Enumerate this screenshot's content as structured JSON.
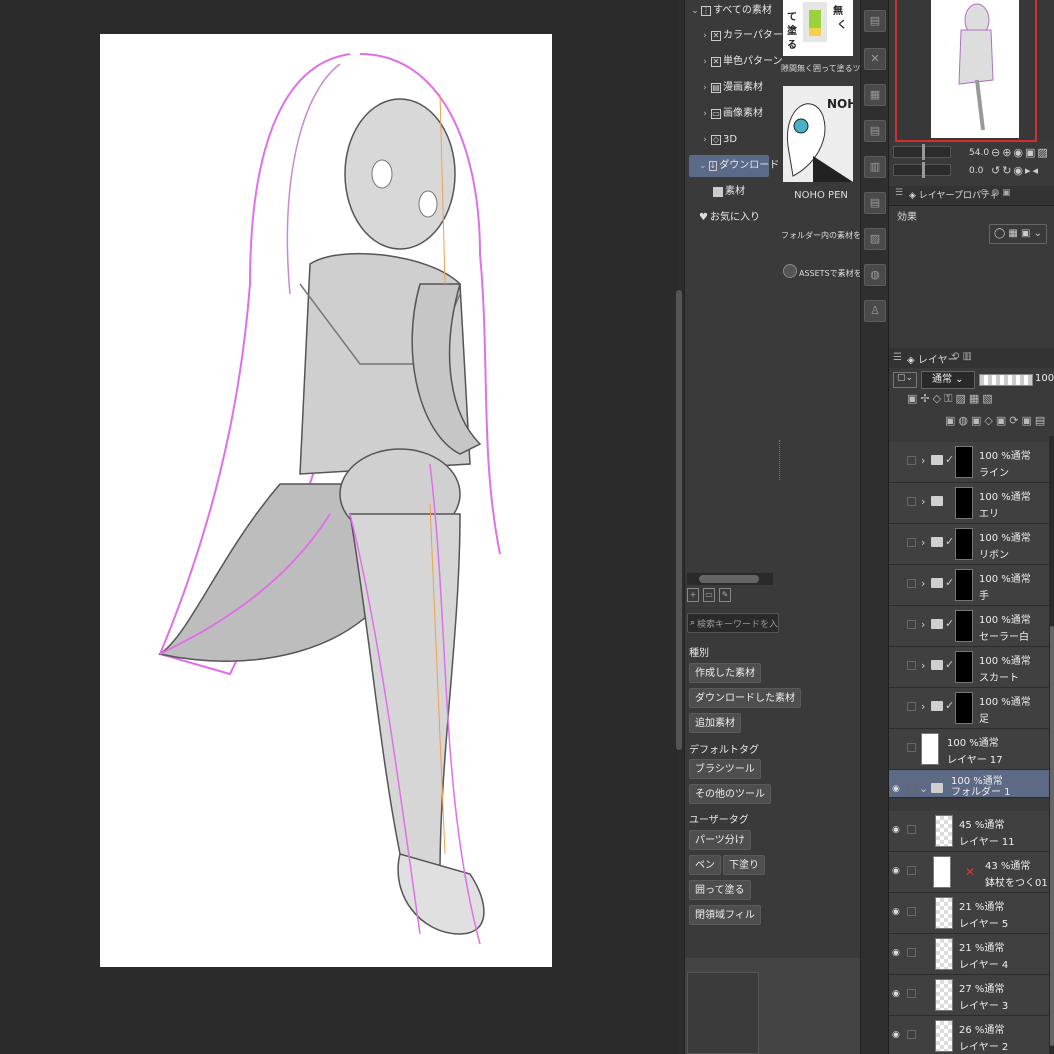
{
  "materials": {
    "tree": [
      {
        "label": "すべての素材"
      },
      {
        "label": "カラーパターン"
      },
      {
        "label": "単色パターン"
      },
      {
        "label": "漫画素材"
      },
      {
        "label": "画像素材"
      },
      {
        "label": "3D"
      },
      {
        "label": "ダウンロード"
      },
      {
        "label": "素材"
      },
      {
        "label": "お気に入り"
      }
    ],
    "thumbs": [
      {
        "caption": "隙間無く囲って塗るツー"
      },
      {
        "caption": "NOHO PEN",
        "art_text": "NOHO PEN"
      },
      {
        "caption": "フォルダー内の素材をすべて"
      },
      {
        "caption": "ASSETSで素材を"
      }
    ],
    "search_placeholder": "検索キーワードを入...",
    "type_label": "種別",
    "type_buttons": [
      "作成した素材",
      "ダウンロードした素材",
      "追加素材"
    ],
    "default_tag_label": "デフォルトタグ",
    "default_tags": [
      "ブラシツール",
      "その他のツール"
    ],
    "user_tag_label": "ユーザータグ",
    "user_tags": [
      "パーツ分け",
      "ペン",
      "下塗り",
      "囲って塗る",
      "閉領域フィル"
    ]
  },
  "navigator": {
    "zoom": "54.0",
    "rotation": "0.0"
  },
  "properties": {
    "tab_label": "レイヤープロパティ",
    "effect_label": "効果"
  },
  "layers": {
    "tab_label": "レイヤー",
    "blend_mode": "通常",
    "opacity": "100",
    "rows": [
      {
        "mode": "100 %通常",
        "name": "ライン"
      },
      {
        "mode": "100 %通常",
        "name": "エリ"
      },
      {
        "mode": "100 %通常",
        "name": "リボン"
      },
      {
        "mode": "100 %通常",
        "name": "手"
      },
      {
        "mode": "100 %通常",
        "name": "セーラー白"
      },
      {
        "mode": "100 %通常",
        "name": "スカート"
      },
      {
        "mode": "100 %通常",
        "name": "足"
      },
      {
        "mode": "100 %通常",
        "name": "レイヤー 17"
      },
      {
        "mode": "100 %通常",
        "name": "フォルダー 1"
      },
      {
        "mode": "45 %通常",
        "name": "レイヤー 11"
      },
      {
        "mode": "43 %通常",
        "name": "鉢杖をつく01"
      },
      {
        "mode": "21 %通常",
        "name": "レイヤー 5"
      },
      {
        "mode": "21 %通常",
        "name": "レイヤー 4"
      },
      {
        "mode": "27 %通常",
        "name": "レイヤー 3"
      },
      {
        "mode": "26 %通常",
        "name": "レイヤー 2"
      }
    ]
  },
  "colors": {
    "selection": "#5a6a88",
    "sketch_pink": "#e070e8",
    "navigator_frame": "#d23030"
  }
}
